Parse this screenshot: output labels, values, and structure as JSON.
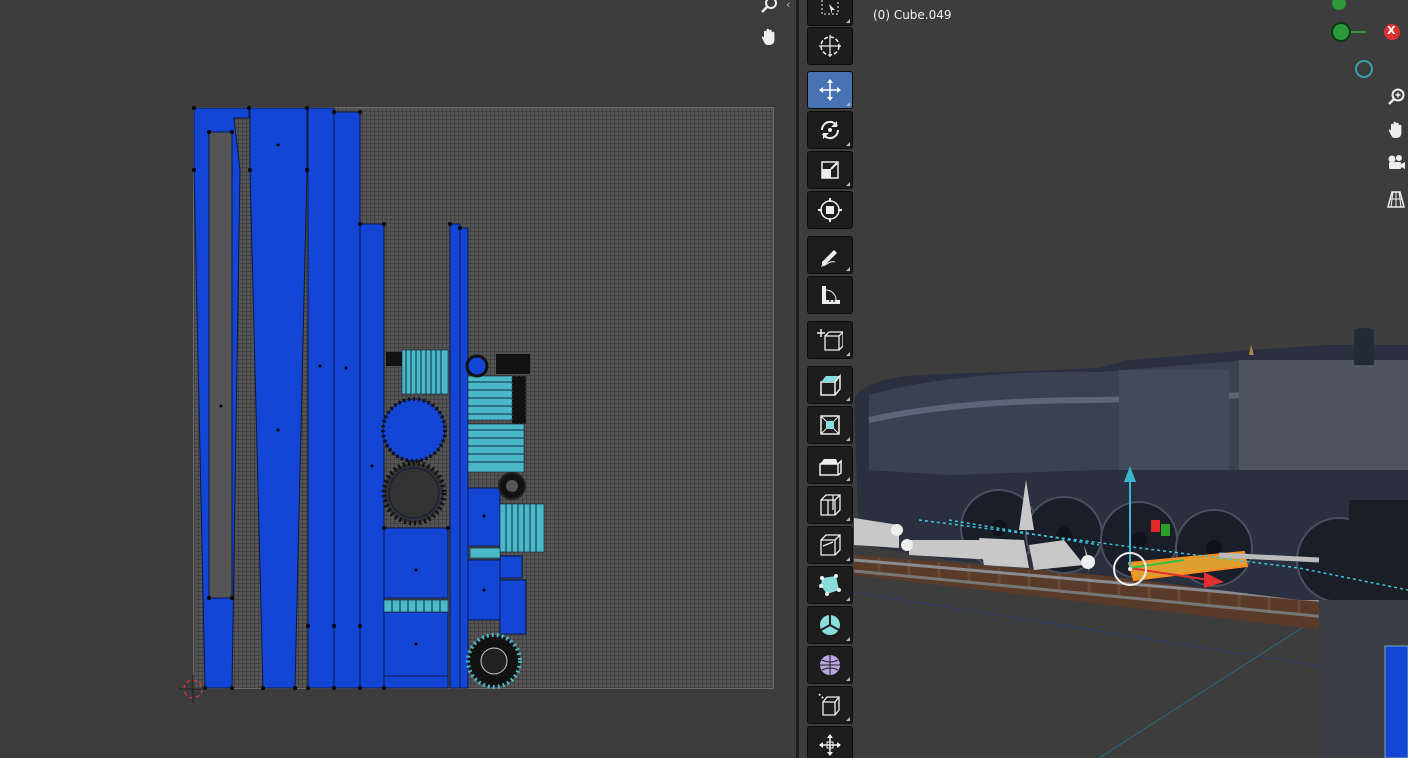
{
  "uv_editor": {
    "nav": {
      "zoom_icon": "zoom",
      "pan_icon": "pan"
    }
  },
  "viewport": {
    "object_name": "(0) Cube.049",
    "object_name_partial": "",
    "gizmo": {
      "x_label": "X"
    },
    "tools": [
      {
        "name": "select-box",
        "active": false
      },
      {
        "name": "cursor",
        "active": false
      },
      {
        "name": "move",
        "active": true
      },
      {
        "name": "rotate",
        "active": false
      },
      {
        "name": "scale",
        "active": false
      },
      {
        "name": "transform",
        "active": false
      },
      {
        "name": "annotate",
        "active": false
      },
      {
        "name": "measure",
        "active": false
      },
      {
        "name": "add-cube",
        "active": false
      },
      {
        "name": "extrude-region",
        "active": false
      },
      {
        "name": "inset-faces",
        "active": false
      },
      {
        "name": "bevel",
        "active": false
      },
      {
        "name": "loop-cut",
        "active": false
      },
      {
        "name": "knife",
        "active": false
      },
      {
        "name": "poly-build",
        "active": false
      },
      {
        "name": "spin",
        "active": false
      },
      {
        "name": "smooth",
        "active": false
      },
      {
        "name": "shear",
        "active": false
      },
      {
        "name": "rip",
        "active": false
      }
    ],
    "nav_icons": [
      "zoom-icon",
      "pan-icon",
      "camera-icon",
      "perspective-grid-icon"
    ]
  },
  "colors": {
    "uv_island_fill": "#1446d6",
    "uv_island_light": "#4ab8c8",
    "active_tool": "#4772b3",
    "toolbar_bg": "#1d1d1d"
  }
}
